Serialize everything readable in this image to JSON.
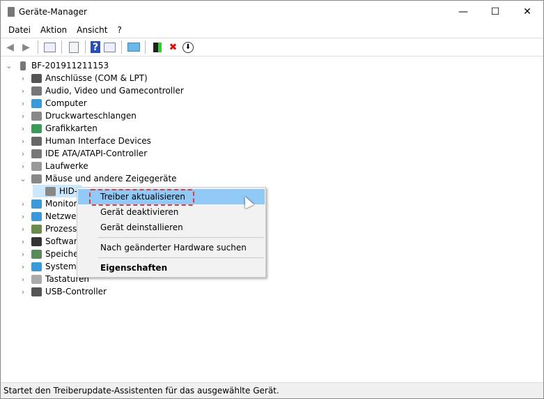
{
  "window": {
    "title": "Geräte-Manager",
    "minimize": "—",
    "maximize": "☐",
    "close": "✕"
  },
  "menu": [
    "Datei",
    "Aktion",
    "Ansicht",
    "?"
  ],
  "toolbar": {
    "back": "◀",
    "forward": "▶",
    "help": "?",
    "remove": "✖",
    "download": "⬇"
  },
  "tree": {
    "root": "BF-201911211153",
    "items": [
      {
        "label": "Anschlüsse (COM & LPT)",
        "color": "#555"
      },
      {
        "label": "Audio, Video und Gamecontroller",
        "color": "#777"
      },
      {
        "label": "Computer",
        "color": "#3a9ad9"
      },
      {
        "label": "Druckwarteschlangen",
        "color": "#888"
      },
      {
        "label": "Grafikkarten",
        "color": "#3a9a5a"
      },
      {
        "label": "Human Interface Devices",
        "color": "#666"
      },
      {
        "label": "IDE ATA/ATAPI-Controller",
        "color": "#777"
      },
      {
        "label": "Laufwerke",
        "color": "#999"
      },
      {
        "label": "Mäuse und andere Zeigegeräte",
        "color": "#888",
        "expanded": true
      },
      {
        "label": "HID-",
        "color": "#888",
        "child": true
      },
      {
        "label": "Monitor",
        "color": "#3a9ad9"
      },
      {
        "label": "Netzwer",
        "color": "#3a9ad9"
      },
      {
        "label": "Prozesso",
        "color": "#6a8a4a"
      },
      {
        "label": "Software",
        "color": "#333"
      },
      {
        "label": "Speicher",
        "color": "#5a8a5a"
      },
      {
        "label": "Systemg",
        "color": "#3a9ad9"
      },
      {
        "label": "Tastaturen",
        "color": "#aaa"
      },
      {
        "label": "USB-Controller",
        "color": "#555"
      }
    ]
  },
  "context_menu": {
    "items": [
      "Treiber aktualisieren",
      "Gerät deaktivieren",
      "Gerät deinstallieren",
      "Nach geänderter Hardware suchen",
      "Eigenschaften"
    ]
  },
  "status": "Startet den Treiberupdate-Assistenten für das ausgewählte Gerät."
}
